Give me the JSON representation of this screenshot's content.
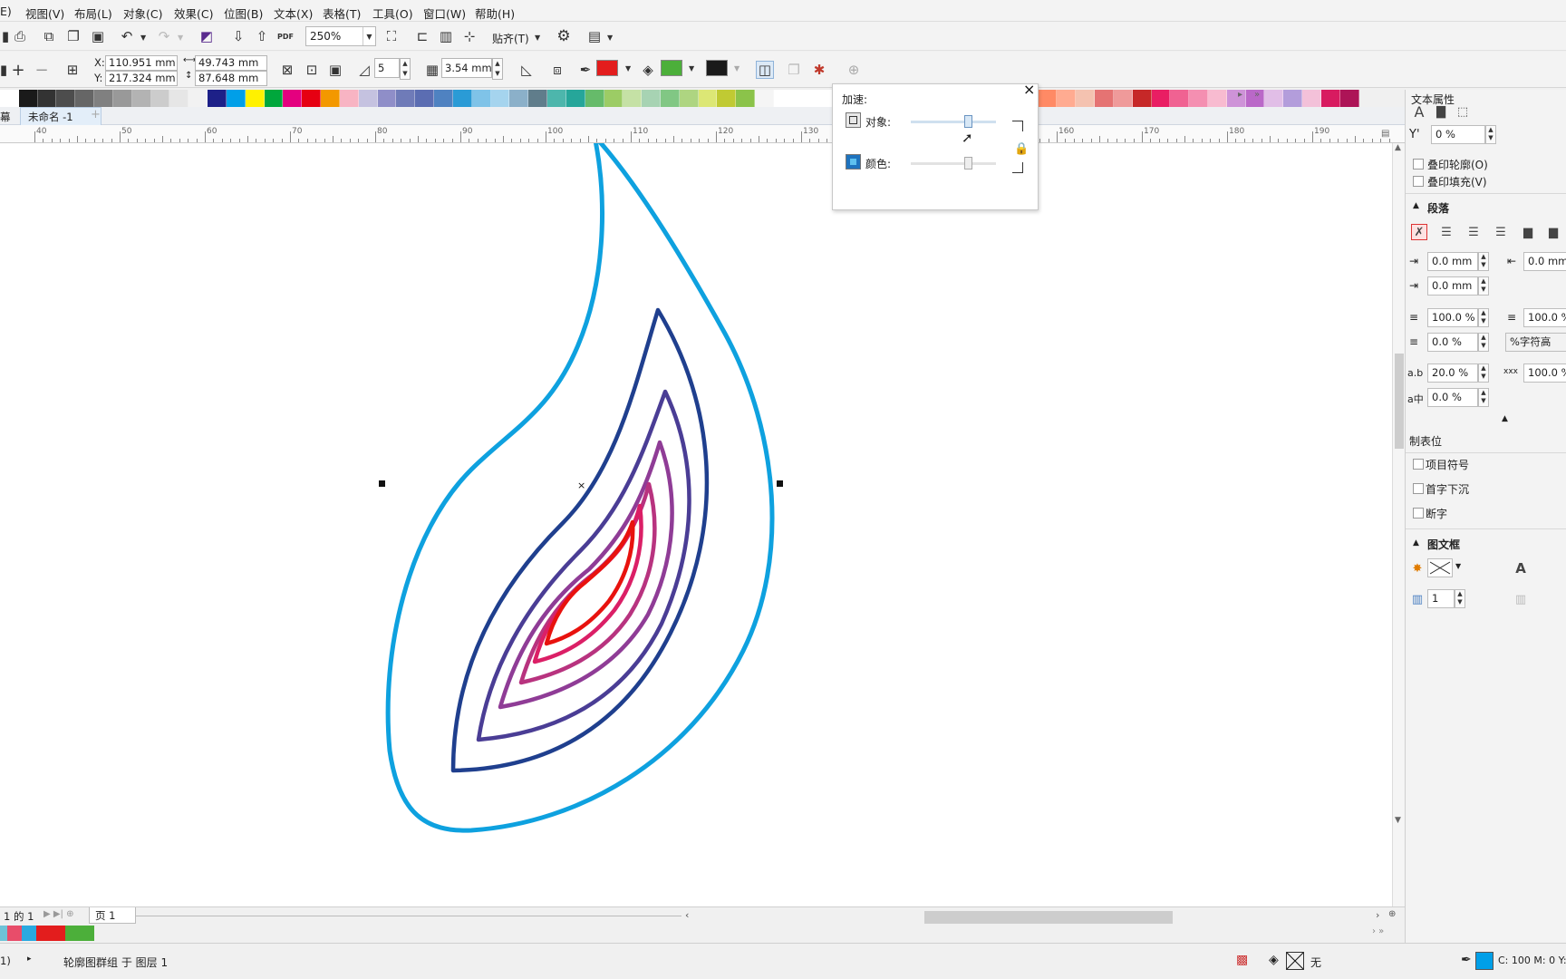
{
  "menu": [
    "E)",
    "视图(V)",
    "布局(L)",
    "对象(C)",
    "效果(C)",
    "位图(B)",
    "文本(X)",
    "表格(T)",
    "工具(O)",
    "窗口(W)",
    "帮助(H)"
  ],
  "toolbar1": {
    "zoom": "250%",
    "snap_label": "贴齐(T)",
    "pdf_label": "PDF"
  },
  "property_bar": {
    "x": "110.951 mm",
    "y": "217.324 mm",
    "x_label": "X:",
    "y_label": "Y:",
    "width": "49.743 mm",
    "height": "87.648 mm",
    "steps": "5",
    "offset": "3.54 mm",
    "outline_color": "#e31d1d",
    "fill_color": "#4caf3a",
    "object_color": "#1a1a1a"
  },
  "palette": [
    "#ffffff",
    "#1a1a1a",
    "#333333",
    "#4d4d4d",
    "#666666",
    "#808080",
    "#999999",
    "#b3b3b3",
    "#cccccc",
    "#e6e6e6",
    "#f2f2f2",
    "#1d2088",
    "#009fe8",
    "#fff100",
    "#00a73c",
    "#e4007f",
    "#e60012",
    "#f39800",
    "#f8b4c3",
    "#c5c2e0",
    "#8f8ec8",
    "#6f7bb8",
    "#5b6db2",
    "#4f82c1",
    "#2a9bd6",
    "#7fc3e8",
    "#a5d4ee",
    "#8bb0c9",
    "#607d8b",
    "#4db6ac",
    "#26a69a",
    "#66bb6a",
    "#9ccc65",
    "#c5e1a5",
    "#a7d3b3",
    "#81c784",
    "#aed581",
    "#dce775",
    "#c0ca33",
    "#8bc34a",
    "#f5f5f5",
    "#ffffff",
    "#ffffff",
    "#ffffff",
    "#ffffff",
    "#ffffff",
    "#ffffff",
    "#ffffff",
    "#ffffff",
    "#ffffff",
    "#ffffff",
    "#ffffff",
    "#8d6e63",
    "#d84315",
    "#ef6c00",
    "#ff8a65",
    "#ffab91",
    "#f4c2b0",
    "#e57373",
    "#ef9a9a",
    "#c62828",
    "#e91e63",
    "#f06292",
    "#f48fb1",
    "#f8bbd0",
    "#ce93d8",
    "#ba68c8",
    "#e1bee7",
    "#b39ddb",
    "#f3c1d9",
    "#d81b60",
    "#ad1457"
  ],
  "doc_tabs": {
    "left_label": "幕",
    "doc_name": "未命名 -1",
    "add": "+"
  },
  "ruler": [
    "40",
    "50",
    "60",
    "70",
    "80",
    "90",
    "100",
    "110",
    "120",
    "130",
    "140",
    "150",
    "160",
    "170",
    "180",
    "190"
  ],
  "blend_popup": {
    "title": "加速:",
    "object_label": "对象:",
    "color_label": "颜色:",
    "object_accel": 0.67,
    "color_accel": 0.67
  },
  "docker": {
    "title": "文本属性",
    "y_value": "0 %",
    "overprint_outline": "叠印轮廓(O)",
    "overprint_fill": "叠印填充(V)",
    "paragraph_title": "段落",
    "indent1": "0.0 mm",
    "indent2": "0.0 mm",
    "indent_right": "0.0 mm",
    "line_spacing": "100.0 %",
    "line_spacing_right": "100.0 %",
    "para_before": "0.0 %",
    "para_unit": "%字符高",
    "char_spacing": "20.0 %",
    "word_spacing": "100.0 %",
    "lang_spacing": "0.0 %",
    "tabs": "制表位",
    "bullets": "项目符号",
    "dropcap": "首字下沉",
    "hyphen": "断字",
    "frame_title": "图文框",
    "columns": "1"
  },
  "page_bar": {
    "pages": "1 的 1",
    "page_tab": "页 1"
  },
  "doc_palette": [
    "#6ec3d8",
    "#e84d6a",
    "#2aa9e0",
    "#e31d1d",
    "#e31d1d",
    "#4caf3a",
    "#4caf3a"
  ],
  "status": {
    "left": "1)",
    "message": "轮廓图群组 于 图层 1",
    "fill_none": "无",
    "color_info": "C: 100 M: 0 Y:"
  },
  "drawing": {
    "outer_color": "#0ea1df",
    "contours": [
      "#1f3f8e",
      "#4a3d95",
      "#8f3c96",
      "#b8337f",
      "#db1f66",
      "#e8120e"
    ]
  }
}
